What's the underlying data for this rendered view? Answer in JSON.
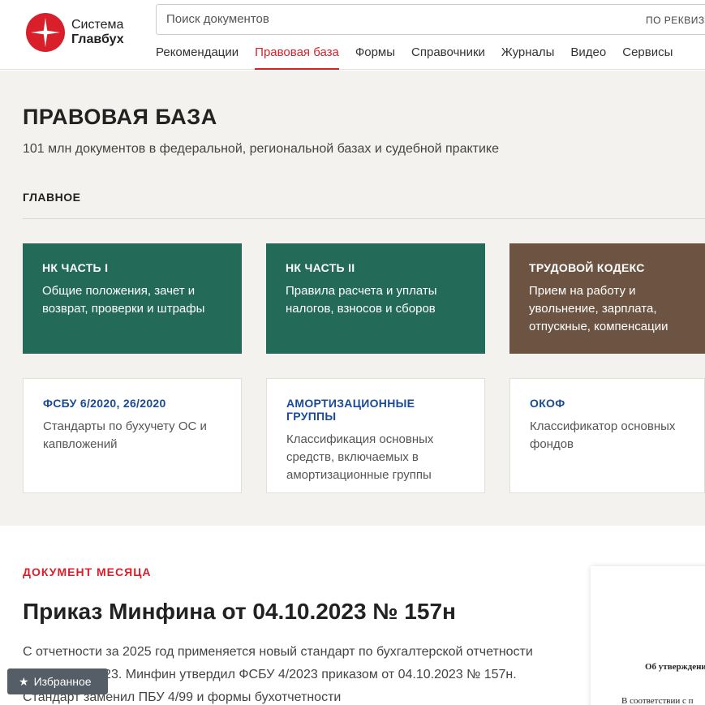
{
  "header": {
    "logo_line1": "Система",
    "logo_line2": "Главбух",
    "search_placeholder": "Поиск документов",
    "search_mode": "ПО РЕКВИЗИТАМ",
    "nav": [
      {
        "label": "Рекомендации",
        "active": false
      },
      {
        "label": "Правовая база",
        "active": true
      },
      {
        "label": "Формы",
        "active": false
      },
      {
        "label": "Справочники",
        "active": false
      },
      {
        "label": "Журналы",
        "active": false
      },
      {
        "label": "Видео",
        "active": false
      },
      {
        "label": "Сервисы",
        "active": false
      }
    ]
  },
  "legal": {
    "title": "ПРАВОВАЯ БАЗА",
    "subtitle": "101 млн документов в федеральной, региональной базах и судебной практике",
    "section": "ГЛАВНОЕ",
    "cards": [
      {
        "title": "НК ЧАСТЬ I",
        "desc": "Общие положения, зачет и возврат, проверки и штрафы"
      },
      {
        "title": "НК ЧАСТЬ II",
        "desc": "Правила расчета и уплаты налогов, взносов и сборов"
      },
      {
        "title": "ТРУДОВОЙ КОДЕКС",
        "desc": "Прием на работу и увольнение, зарплата, отпускные, компенсации"
      },
      {
        "title": "ФСБУ 6/2020, 26/2020",
        "desc": "Стандарты по бухучету ОС и капвложений"
      },
      {
        "title": "АМОРТИЗАЦИОННЫЕ ГРУППЫ",
        "desc": "Классификация основных средств, включаемых в амортизационные группы"
      },
      {
        "title": "ОКОФ",
        "desc": "Классификатор основных фондов"
      }
    ],
    "colors": {
      "green": "#236b58",
      "brown": "#6d5442",
      "link_blue": "#1a4a96"
    }
  },
  "doc_month": {
    "label": "ДОКУМЕНТ МЕСЯЦА",
    "title": "Приказ Минфина от 04.10.2023 № 157н",
    "text": "С отчетности за 2025 год применяется новый стандарт по бухгалтерской отчетности — ФСБУ 4/2023. Минфин утвердил ФСБУ 4/2023 приказом от 04.10.2023 № 157н. Стандарт заменил ПБУ 4/99 и формы бухотчетности",
    "preview_line1": "Об утверждении",
    "preview_line2": "В соответствии с п"
  },
  "favorites": {
    "label": "Избранное",
    "icon": "star-icon"
  },
  "accent": "#d9202a"
}
